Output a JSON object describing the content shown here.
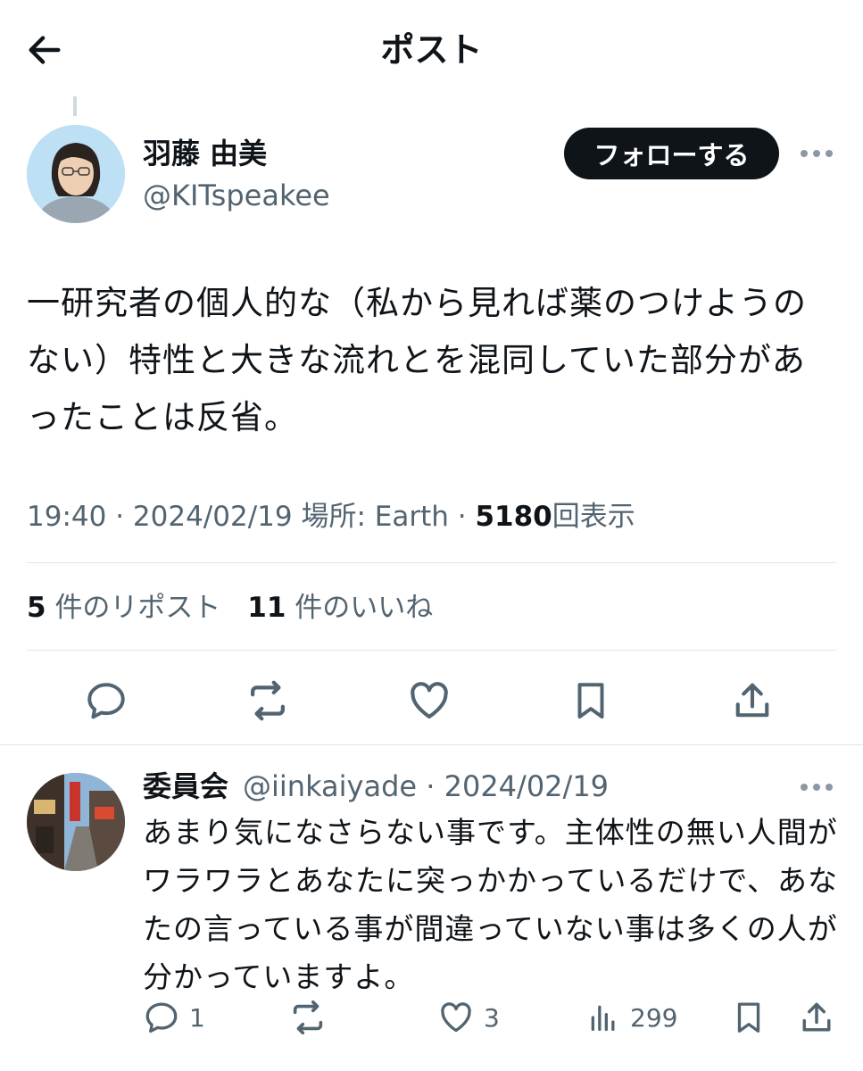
{
  "header": {
    "title": "ポスト",
    "back_icon": "arrow-left-icon"
  },
  "post": {
    "author_name": "羽藤 由美",
    "author_handle": "@KITspeakee",
    "follow_label": "フォローする",
    "text": "一研究者の個人的な（私から見れば薬のつけようのない）特性と大きな流れとを混同していた部分があったことは反省。",
    "meta": {
      "time": "19:40",
      "sep": " · ",
      "date": "2024/02/19",
      "location_label": "場所: ",
      "location": "Earth",
      "views": "5180",
      "views_label": "回表示"
    },
    "stats": {
      "reposts": "5",
      "reposts_label": "件のリポスト",
      "likes": "11",
      "likes_label": "件のいいね"
    },
    "actions": [
      "reply-icon",
      "repost-icon",
      "like-icon",
      "bookmark-icon",
      "share-icon"
    ]
  },
  "reply": {
    "author_name": "委員会",
    "author_handle": "@iinkaiyade",
    "sep": " · ",
    "date": "2024/02/19",
    "text": "あまり気になさらない事です。主体性の無い人間がワラワラとあなたに突っかかっているだけで、あなたの言っている事が間違っていない事は多くの人が分かっていますよ。",
    "counts": {
      "replies": "1",
      "likes": "3",
      "views": "299"
    }
  },
  "colors": {
    "text": "#0f1419",
    "secondary": "#536471",
    "divider": "#e1e6ea",
    "button": "#0f1419"
  }
}
